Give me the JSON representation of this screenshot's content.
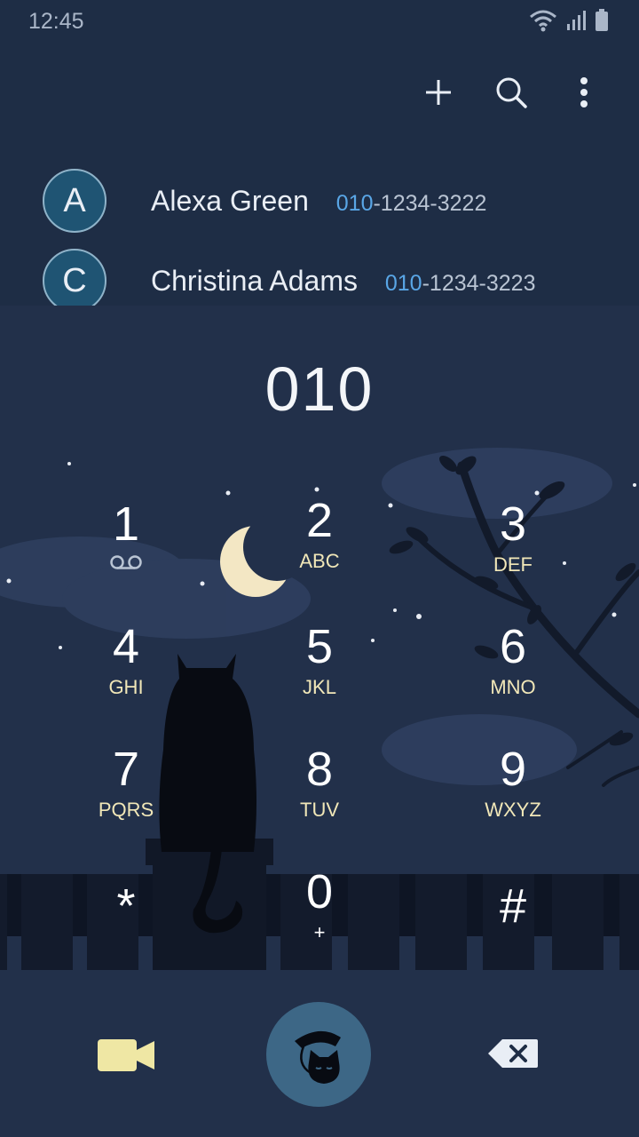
{
  "status": {
    "time": "12:45"
  },
  "toolbar": {
    "add_icon": "plus-icon",
    "search_icon": "search-icon",
    "more_icon": "more-vertical-icon"
  },
  "contacts": [
    {
      "initial": "A",
      "name": "Alexa Green",
      "number_match": "010",
      "number_rest": "-1234-3222"
    },
    {
      "initial": "C",
      "name": "Christina Adams",
      "number_match": "010",
      "number_rest": "-1234-3223"
    }
  ],
  "dialer": {
    "input": "010"
  },
  "keys": [
    {
      "digit": "1",
      "letters": "",
      "icon": "voicemail-icon"
    },
    {
      "digit": "2",
      "letters": "ABC"
    },
    {
      "digit": "3",
      "letters": "DEF"
    },
    {
      "digit": "4",
      "letters": "GHI"
    },
    {
      "digit": "5",
      "letters": "JKL"
    },
    {
      "digit": "6",
      "letters": "MNO"
    },
    {
      "digit": "7",
      "letters": "PQRS"
    },
    {
      "digit": "8",
      "letters": "TUV"
    },
    {
      "digit": "9",
      "letters": "WXYZ"
    },
    {
      "digit": "*",
      "letters": ""
    },
    {
      "digit": "0",
      "letters": "+"
    },
    {
      "digit": "#",
      "letters": ""
    }
  ],
  "actions": {
    "video_icon": "video-call-icon",
    "call_icon": "cat-phone-call-icon",
    "backspace_icon": "backspace-icon"
  },
  "colors": {
    "background": "#1e2d45",
    "accent_match": "#59a6e6",
    "letters": "#f1e7b8",
    "call_button": "#3d6786",
    "moon": "#f3e7c4"
  }
}
